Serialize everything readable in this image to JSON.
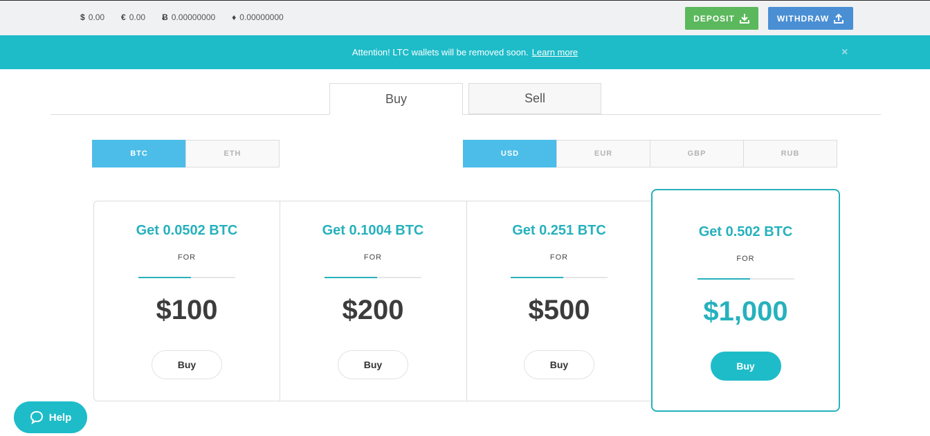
{
  "balances": [
    {
      "symbol": "$",
      "value": "0.00",
      "icon": "dollar-icon"
    },
    {
      "symbol": "€",
      "value": "0.00",
      "icon": "euro-icon"
    },
    {
      "symbol": "Ƀ",
      "value": "0.00000000",
      "icon": "bitcoin-icon"
    },
    {
      "symbol": "♦",
      "value": "0.00000000",
      "icon": "ethereum-icon"
    }
  ],
  "toolbar": {
    "deposit_label": "DEPOSIT",
    "withdraw_label": "WITHDRAW",
    "deposit_color": "#5cb85c",
    "withdraw_color": "#4a8fd4"
  },
  "banner": {
    "text": "Attention! LTC wallets will be removed soon.",
    "link": "Learn more",
    "close": "×",
    "color": "#1ebcc9"
  },
  "tabs": [
    {
      "label": "Buy",
      "active": true
    },
    {
      "label": "Sell",
      "active": false
    }
  ],
  "crypto_options": [
    {
      "label": "BTC",
      "active": true
    },
    {
      "label": "ETH",
      "active": false
    }
  ],
  "fiat_options": [
    {
      "label": "USD",
      "active": true
    },
    {
      "label": "EUR",
      "active": false
    },
    {
      "label": "GBP",
      "active": false
    },
    {
      "label": "RUB",
      "active": false
    }
  ],
  "offers": [
    {
      "get": "Get 0.0502 BTC",
      "for": "FOR",
      "price": "$100",
      "buy": "Buy",
      "highlighted": false
    },
    {
      "get": "Get 0.1004 BTC",
      "for": "FOR",
      "price": "$200",
      "buy": "Buy",
      "highlighted": false
    },
    {
      "get": "Get 0.251 BTC",
      "for": "FOR",
      "price": "$500",
      "buy": "Buy",
      "highlighted": false
    },
    {
      "get": "Get 0.502 BTC",
      "for": "FOR",
      "price": "$1,000",
      "buy": "Buy",
      "highlighted": true
    }
  ],
  "help": {
    "label": "Help"
  },
  "accent_color": "#26b1bd"
}
